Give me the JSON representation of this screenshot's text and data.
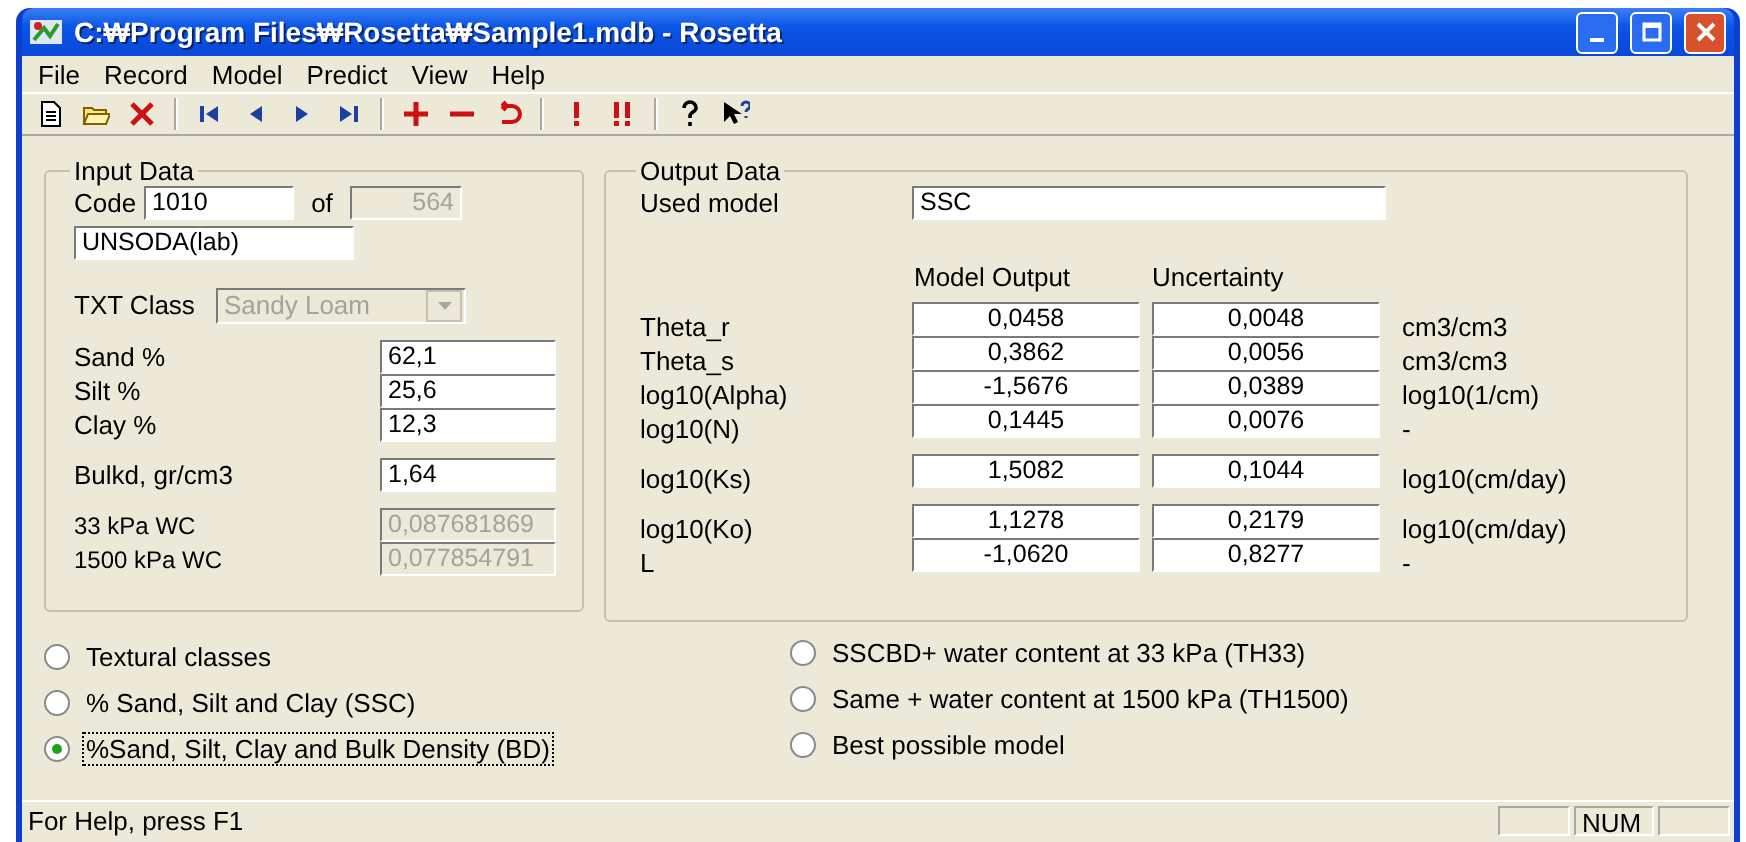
{
  "window": {
    "title": "C:₩Program Files₩Rosetta₩Sample1.mdb - Rosetta"
  },
  "menu": [
    {
      "label": "File"
    },
    {
      "label": "Record"
    },
    {
      "label": "Model"
    },
    {
      "label": "Predict"
    },
    {
      "label": "View"
    },
    {
      "label": "Help"
    }
  ],
  "input_data": {
    "title": "Input Data",
    "code_label": "Code",
    "code": "1010",
    "of_label": "of",
    "total": "564",
    "source": "UNSODA(lab)",
    "txt_class": {
      "label": "TXT Class",
      "value": "Sandy Loam",
      "disabled": true
    },
    "field_groups": [
      [
        {
          "label": "Sand %",
          "value": "62,1",
          "disabled": false
        },
        {
          "label": "Silt %",
          "value": "25,6",
          "disabled": false
        },
        {
          "label": "Clay %",
          "value": "12,3",
          "disabled": false
        }
      ],
      [
        {
          "label": "Bulkd, gr/cm3",
          "value": "1,64",
          "disabled": false
        }
      ],
      [
        {
          "label": "33 kPa WC",
          "value": "0,087681869",
          "disabled": true
        },
        {
          "label": "1500 kPa WC",
          "value": "0,077854791",
          "disabled": true
        }
      ]
    ]
  },
  "output_data": {
    "title": "Output Data",
    "used_model_label": "Used model",
    "used_model": "SSC",
    "columns": [
      "Model Output",
      "Uncertainty"
    ],
    "row_groups": [
      [
        {
          "label": "Theta_r",
          "output": "0,0458",
          "uncertainty": "0,0048",
          "unit": "cm3/cm3"
        },
        {
          "label": "Theta_s",
          "output": "0,3862",
          "uncertainty": "0,0056",
          "unit": "cm3/cm3"
        },
        {
          "label": "log10(Alpha)",
          "output": "-1,5676",
          "uncertainty": "0,0389",
          "unit": "log10(1/cm)"
        },
        {
          "label": "log10(N)",
          "output": "0,1445",
          "uncertainty": "0,0076",
          "unit": "-"
        }
      ],
      [
        {
          "label": "log10(Ks)",
          "output": "1,5082",
          "uncertainty": "0,1044",
          "unit": "log10(cm/day)"
        }
      ],
      [
        {
          "label": "log10(Ko)",
          "output": "1,1278",
          "uncertainty": "0,2179",
          "unit": "log10(cm/day)"
        },
        {
          "label": "L",
          "output": "-1,0620",
          "uncertainty": "0,8277",
          "unit": "-"
        }
      ]
    ]
  },
  "models": [
    {
      "label": "Textural classes",
      "selected": false
    },
    {
      "label": "% Sand, Silt and Clay (SSC)",
      "selected": false
    },
    {
      "label": "%Sand, Silt, Clay and Bulk Density (BD)",
      "selected": true
    },
    {
      "label": "SSCBD+ water content at 33 kPa (TH33)",
      "selected": false
    },
    {
      "label": "Same + water content at 1500 kPa (TH1500)",
      "selected": false
    },
    {
      "label": "Best possible model",
      "selected": false
    }
  ],
  "status_bar": {
    "text": "For Help, press F1",
    "panels": [
      "NUM"
    ]
  }
}
